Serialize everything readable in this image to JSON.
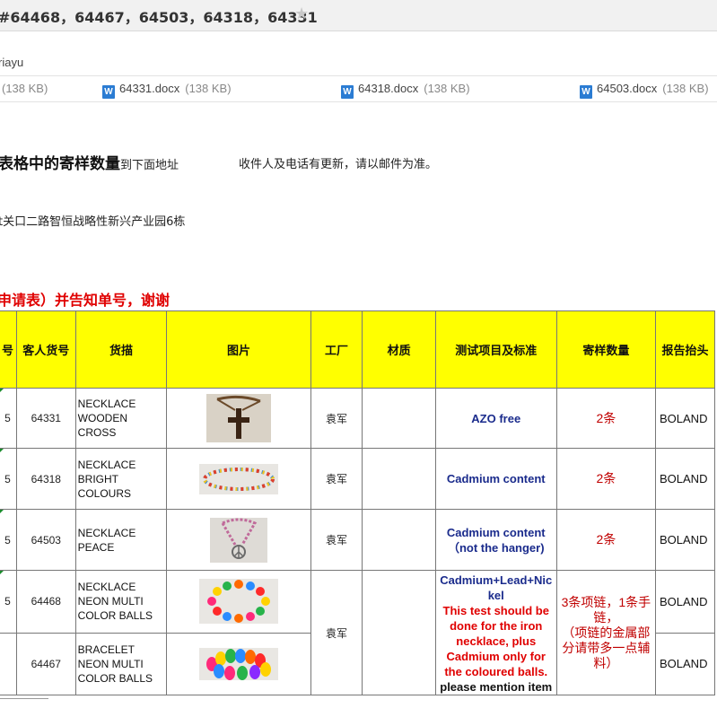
{
  "email": {
    "subject": "#64468，64467，64503，64318，64331",
    "sender": "riayu",
    "attachments": [
      {
        "name": "",
        "size": "(138 KB)"
      },
      {
        "name": "64331.docx",
        "size": "(138 KB)"
      },
      {
        "name": "64318.docx",
        "size": "(138 KB)"
      },
      {
        "name": "64503.docx",
        "size": "(138 KB)"
      }
    ],
    "word_icon": "W"
  },
  "body": {
    "line1_bold": "表格中的寄样数量",
    "line1_rest": "到下面地址",
    "line1_note": "收件人及电话有更新，请以邮件为准。",
    "line2": "]",
    "line3": "t关口二路智恒战略性新兴产业园6栋",
    "line4": "申请表）并告知单号，谢谢"
  },
  "table": {
    "headers": [
      "号",
      "客人货号",
      "货描",
      "图片",
      "工厂",
      "材质",
      "测试项目及标准",
      "寄样数量",
      "报告抬头"
    ],
    "rows": [
      {
        "no": "5",
        "item": "64331",
        "desc": [
          "NECKLACE",
          "WOODEN",
          "CROSS"
        ],
        "factory": "袁军",
        "material": "",
        "test": "AZO free",
        "qty": "2条",
        "report": "BOLAND"
      },
      {
        "no": "5",
        "item": "64318",
        "desc": [
          "NECKLACE",
          "BRIGHT",
          "COLOURS"
        ],
        "factory": "袁军",
        "material": "",
        "test": "Cadmium content",
        "qty": "2条",
        "report": "BOLAND"
      },
      {
        "no": "5",
        "item": "64503",
        "desc": [
          "NECKLACE",
          "PEACE"
        ],
        "factory": "袁军",
        "material": "",
        "test_lines": [
          "Cadmium content",
          "（not the hanger)"
        ],
        "qty": "2条",
        "report": "BOLAND"
      },
      {
        "no": "5",
        "item": "64468",
        "desc": [
          "NECKLACE",
          "NEON MULTI",
          "COLOR BALLS"
        ],
        "report": "BOLAND"
      },
      {
        "no": "",
        "item": "64467",
        "desc": [
          "BRACELET",
          "NEON MULTI",
          "COLOR BALLS"
        ],
        "report": "BOLAND"
      }
    ],
    "merged": {
      "factory": "袁军",
      "test_blue": [
        "Cadmium+Lead+Nic",
        "kel"
      ],
      "test_red": [
        "This test should be",
        "done for the iron",
        "necklace, plus",
        "Cadmium only for",
        "the coloured balls."
      ],
      "test_black": "please mention item",
      "qty": [
        "3条项链，1条手",
        "链，",
        "（项链的金属部",
        "分请带多一点辅",
        "料）"
      ]
    }
  }
}
